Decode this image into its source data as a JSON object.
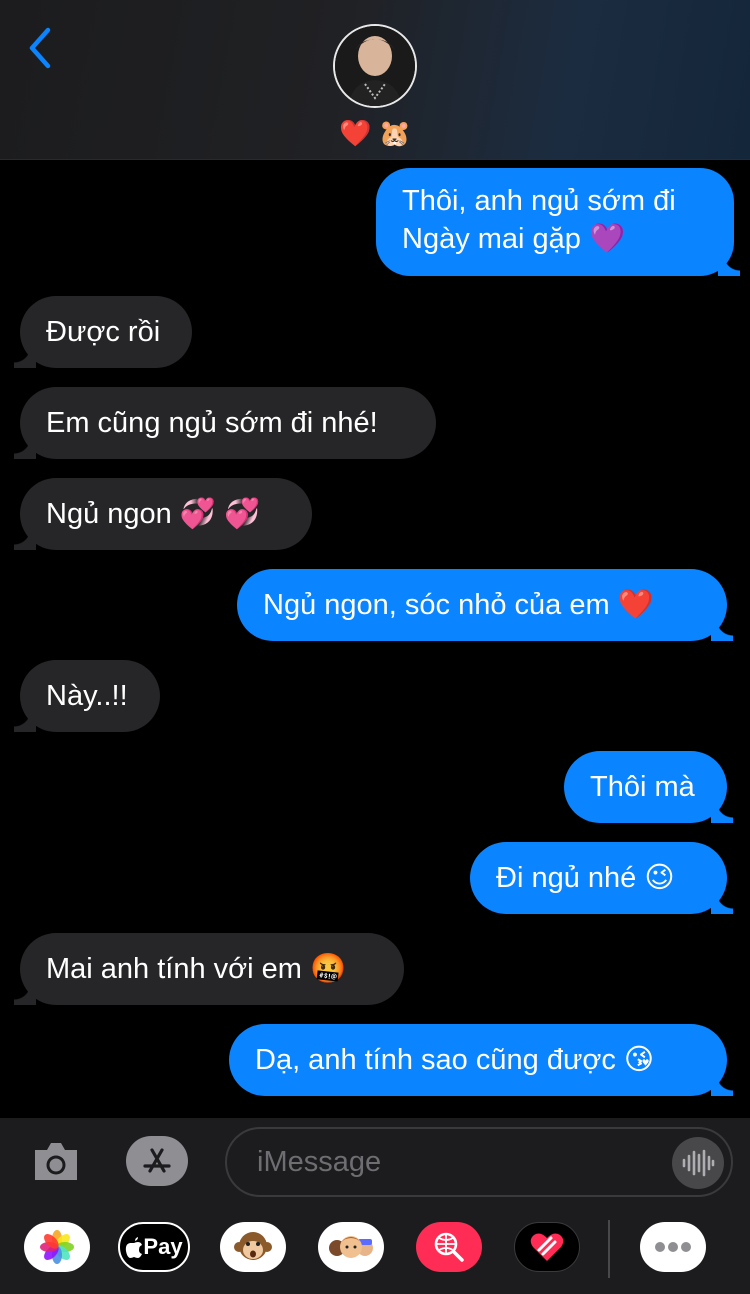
{
  "header": {
    "contact_name": "❤️ 🐹"
  },
  "messages": [
    {
      "side": "out",
      "lines": [
        "Thôi, anh ngủ sớm đi",
        "Ngày mai gặp 💜"
      ]
    },
    {
      "side": "in",
      "text": "Được rồi"
    },
    {
      "side": "in",
      "text": "Em cũng ngủ sớm đi nhé!"
    },
    {
      "side": "in",
      "text": "Ngủ ngon 💞 💞"
    },
    {
      "side": "out",
      "text": "Ngủ ngon, sóc nhỏ của em ❤️"
    },
    {
      "side": "in",
      "text": "Này..!!"
    },
    {
      "side": "out",
      "text": "Thôi mà"
    },
    {
      "side": "out",
      "text": "Đi ngủ nhé 😉"
    },
    {
      "side": "in",
      "text": "Mai anh tính với em 🤬"
    },
    {
      "side": "out",
      "text": "Dạ, anh tính sao cũng được 😘"
    }
  ],
  "input": {
    "placeholder": "iMessage"
  },
  "drawer": {
    "apple_pay_label": "Pay"
  },
  "colors": {
    "sent_bubble": "#0a84ff",
    "received_bubble": "#262628",
    "accent": "#0a84ff"
  }
}
